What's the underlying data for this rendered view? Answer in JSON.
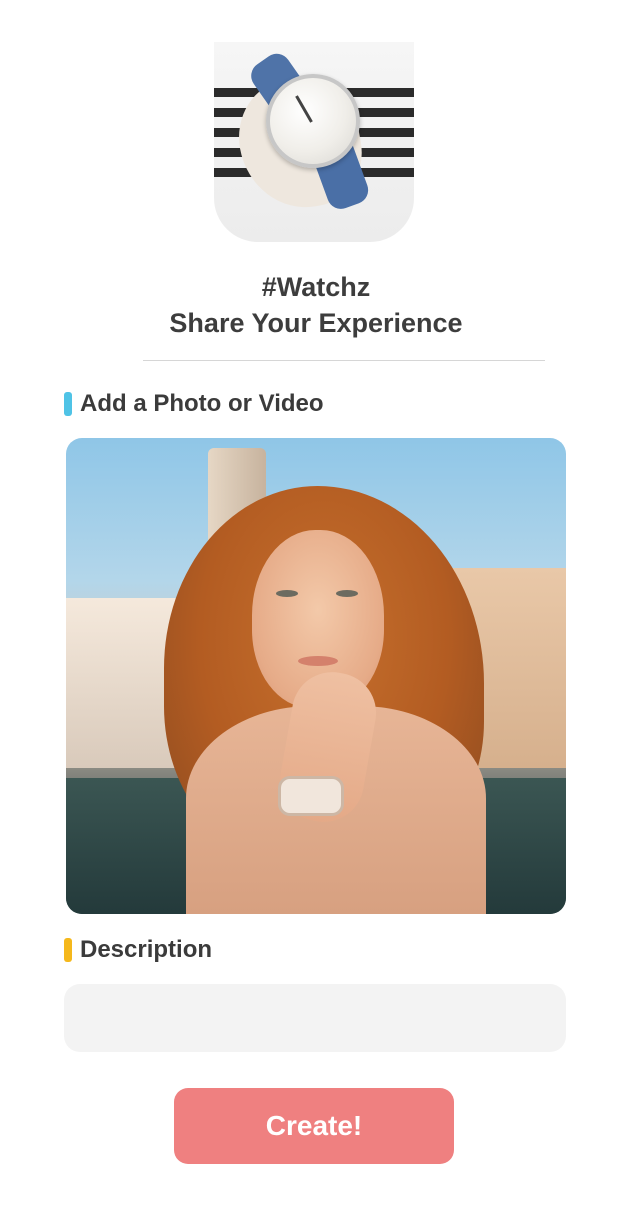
{
  "header": {
    "brand": "#Watchz",
    "subtitle": "Share Your Experience"
  },
  "sections": {
    "media": {
      "label": "Add a Photo or Video",
      "accent_color": "#4fc3e6"
    },
    "description": {
      "label": "Description",
      "accent_color": "#f5b81c",
      "value": "",
      "placeholder": ""
    }
  },
  "actions": {
    "create_label": "Create!",
    "button_color": "#ef8080"
  }
}
